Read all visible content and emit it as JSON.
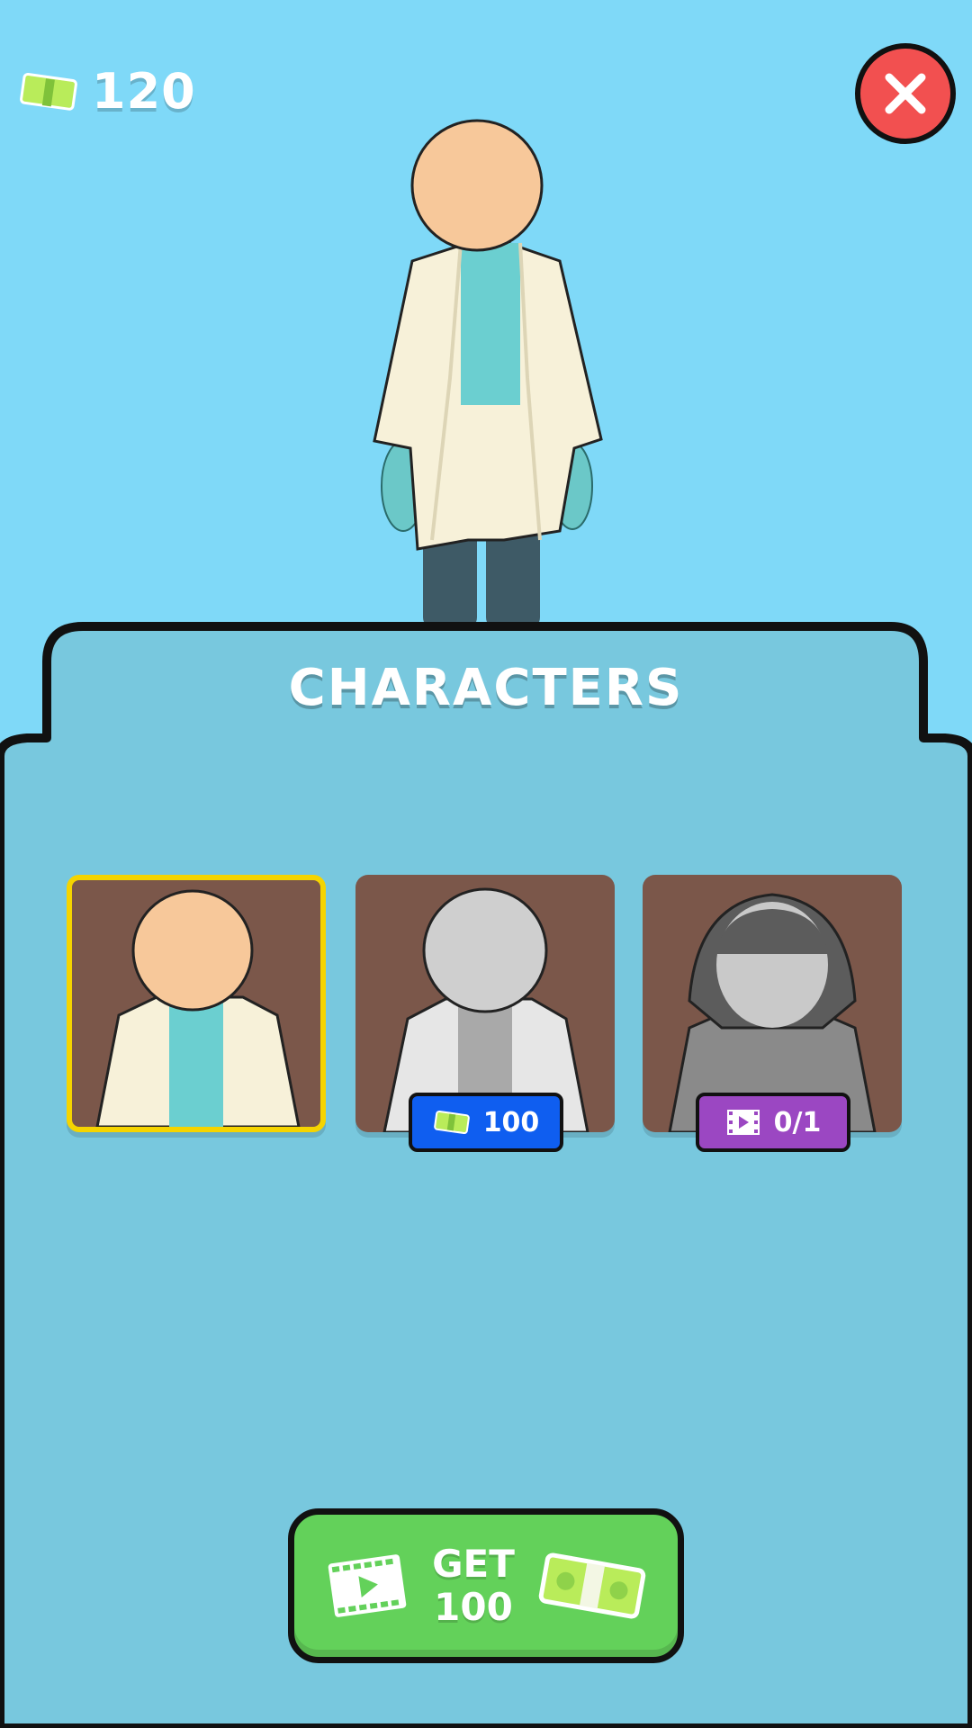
{
  "hud": {
    "currency_value": "120",
    "currency_icon": "cash-icon",
    "close_icon": "close-icon"
  },
  "panel": {
    "title": "CHARACTERS"
  },
  "characters": [
    {
      "name": "scientist",
      "state": "selected"
    },
    {
      "name": "locked-scientist",
      "state": "locked",
      "price": "100"
    },
    {
      "name": "locked-girl",
      "state": "locked",
      "ads_progress": "0/1"
    }
  ],
  "get_button": {
    "line1": "GET",
    "line2": "100",
    "left_icon": "video-ad-icon",
    "right_icon": "cash-icon"
  },
  "colors": {
    "sky": "#7fd9f8",
    "panel": "#78c8de",
    "card": "#7b574a",
    "selected_border": "#f5d400",
    "close_button": "#f25050",
    "price_badge": "#0f5ef0",
    "ads_badge": "#9b47c2",
    "get_button": "#63d15a"
  }
}
